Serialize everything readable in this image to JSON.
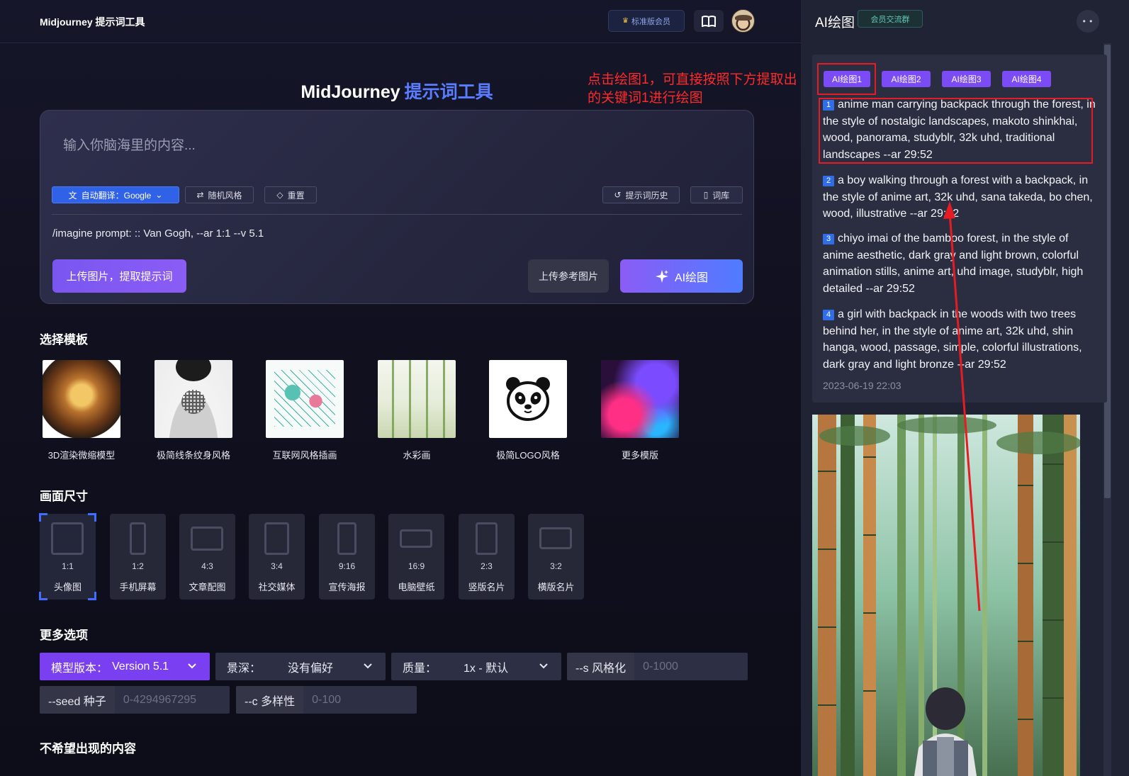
{
  "header": {
    "logo": "Midjourney 提示词工具",
    "member_button": "标准版会员"
  },
  "main": {
    "title_main": "MidJourney",
    "title_accent": "提示词工具",
    "input_placeholder": "输入你脑海里的内容...",
    "toolbar": {
      "translate": "自动翻译：Google",
      "random": "随机风格",
      "reset": "重置",
      "history": "提示词历史",
      "library": "词库"
    },
    "prompt_preview": "/imagine prompt: :: Van Gogh, --ar 1:1 --v 5.1",
    "upload_extract": "上传图片，提取提示词",
    "upload_reference": "上传参考图片",
    "draw_button": "AI绘图"
  },
  "templates": {
    "section_title": "选择模板",
    "items": [
      {
        "label": "3D渲染微缩模型"
      },
      {
        "label": "极简线条纹身风格"
      },
      {
        "label": "互联网风格插画"
      },
      {
        "label": "水彩画"
      },
      {
        "label": "极简LOGO风格"
      },
      {
        "label": "更多模版"
      }
    ]
  },
  "sizes": {
    "section_title": "画面尺寸",
    "items": [
      {
        "ratio": "1:1",
        "label": "头像图"
      },
      {
        "ratio": "1:2",
        "label": "手机屏幕"
      },
      {
        "ratio": "4:3",
        "label": "文章配图"
      },
      {
        "ratio": "3:4",
        "label": "社交媒体"
      },
      {
        "ratio": "9:16",
        "label": "宣传海报"
      },
      {
        "ratio": "16:9",
        "label": "电脑壁纸"
      },
      {
        "ratio": "2:3",
        "label": "竖版名片"
      },
      {
        "ratio": "3:2",
        "label": "横版名片"
      }
    ],
    "selected": "1:1"
  },
  "more_options": {
    "section_title": "更多选项",
    "model": {
      "key": "模型版本：",
      "value": "Version 5.1"
    },
    "depth": {
      "key": "景深：",
      "value": "没有偏好"
    },
    "quality": {
      "key": "质量：",
      "value": "1x - 默认"
    },
    "stylize": {
      "key": "--s 风格化",
      "placeholder": "0-1000"
    },
    "seed": {
      "key": "--seed 种子",
      "placeholder": "0-4294967295"
    },
    "chaos": {
      "key": "--c 多样性",
      "placeholder": "0-100"
    }
  },
  "negative": {
    "section_title": "不希望出现的内容"
  },
  "side": {
    "title": "AI绘图",
    "group_button": "会员交流群",
    "tabs": [
      "AI绘图1",
      "AI绘图2",
      "AI绘图3",
      "AI绘图4"
    ],
    "entries": [
      {
        "num": "1",
        "text": "anime man carrying backpack through the forest, in the style of nostalgic landscapes, makoto shinkhai, wood, panorama, studyblr, 32k uhd, traditional landscapes --ar 29:52"
      },
      {
        "num": "2",
        "text": "a boy walking through a forest with a backpack, in the style of anime art, 32k uhd, sana takeda, bo chen, wood, illustrative --ar 29:52"
      },
      {
        "num": "3",
        "text": "chiyo imai of the bamboo forest, in the style of anime aesthetic, dark gray and light brown, colorful animation stills, anime art, uhd image, studyblr, high detailed --ar 29:52"
      },
      {
        "num": "4",
        "text": "a girl with backpack in the woods with two trees behind her, in the style of anime art, 32k uhd, shin hanga, wood, passage, simple, colorful illustrations, dark gray and light bronze --ar 29:52"
      }
    ],
    "timestamp": "2023-06-19 22:03"
  },
  "annotation": {
    "line1": "点击绘图1，可直接按照下方提取出",
    "line2": "的关键词1进行绘图",
    "color": "#e51c23"
  }
}
